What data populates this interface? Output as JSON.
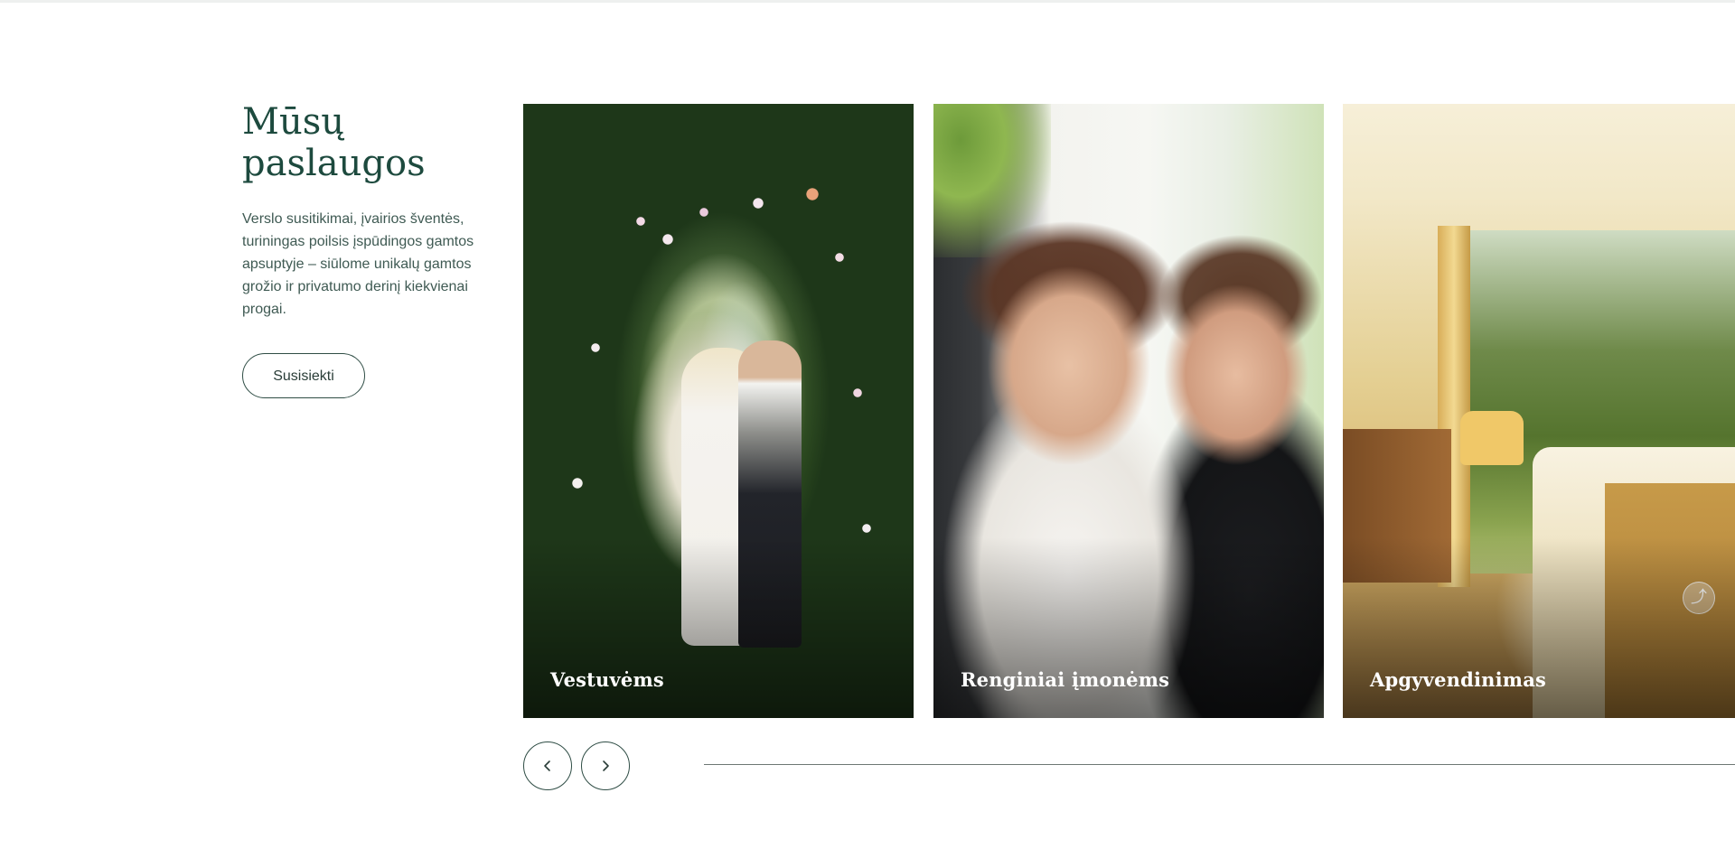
{
  "services": {
    "title": "Mūsų paslaugos",
    "description": "Verslo susitikimai, įvairios šventės, turiningas poilsis įspūdingos gamtos apsuptyje – siūlome unikalų gamtos grožio ir privatumo derinį kiekvienai progai.",
    "contact_label": "Susisiekti"
  },
  "cards": [
    {
      "label": "Vestuvėms",
      "image": "wedding couple under flower arch"
    },
    {
      "label": "Renginiai įmonėms",
      "image": "people applauding at event"
    },
    {
      "label": "Apgyvendinimas",
      "image": "hotel room with forest view"
    }
  ],
  "carousel": {
    "prev_icon": "chevron-left-icon",
    "next_icon": "chevron-right-icon"
  },
  "colors": {
    "heading": "#1d4a3e",
    "text": "#3f5a53",
    "border": "#2f4d45"
  }
}
